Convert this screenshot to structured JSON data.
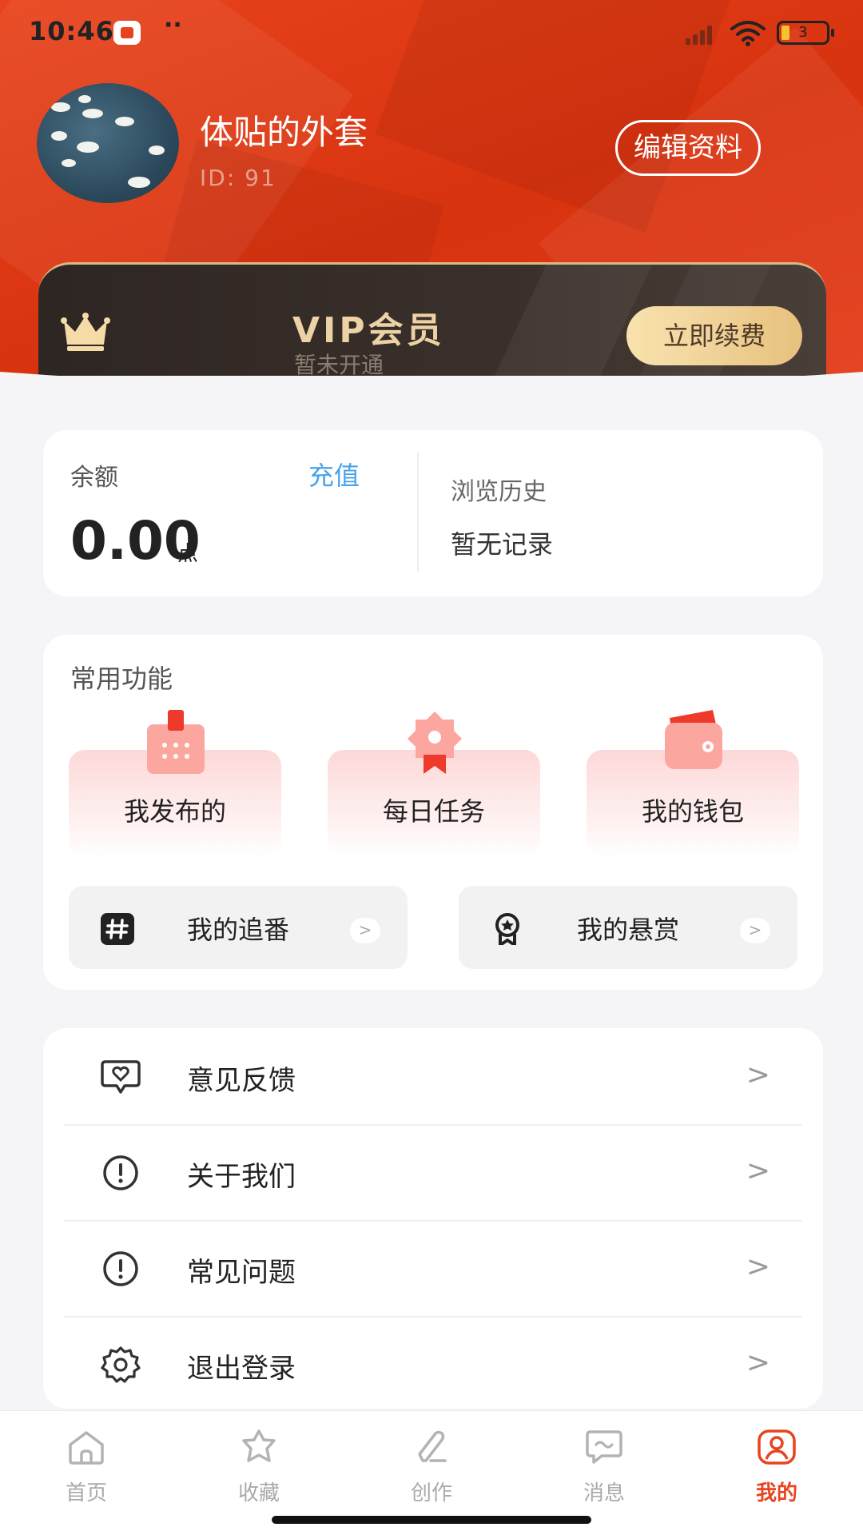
{
  "status_bar": {
    "time": "10:46",
    "dots": "··",
    "battery": "3"
  },
  "profile": {
    "username": "体贴的外套",
    "id_text": "ID: 91",
    "edit_label": "编辑资料"
  },
  "vip": {
    "title": "VIP会员",
    "subtitle": "暂未开通",
    "button": "立即续费"
  },
  "balance": {
    "label": "余额",
    "recharge": "充值",
    "amount": "0.00",
    "unit": "点",
    "history_label": "浏览历史",
    "history_value": "暂无记录"
  },
  "functions": {
    "title": "常用功能",
    "tiles": [
      {
        "label": "我发布的",
        "icon": "calendar-icon"
      },
      {
        "label": "每日任务",
        "icon": "badge-icon"
      },
      {
        "label": "我的钱包",
        "icon": "wallet-icon"
      }
    ],
    "quick": [
      {
        "label": "我的追番",
        "icon": "hashtag-icon"
      },
      {
        "label": "我的悬赏",
        "icon": "medal-icon"
      }
    ],
    "arrow": ">"
  },
  "menu": {
    "items": [
      {
        "label": "意见反馈",
        "icon": "feedback-heart-icon"
      },
      {
        "label": "关于我们",
        "icon": "info-alert-icon"
      },
      {
        "label": "常见问题",
        "icon": "question-alert-icon"
      },
      {
        "label": "退出登录",
        "icon": "gear-icon"
      }
    ],
    "arrow": ">"
  },
  "nav": {
    "items": [
      {
        "label": "首页",
        "icon": "home-icon"
      },
      {
        "label": "收藏",
        "icon": "star-icon"
      },
      {
        "label": "创作",
        "icon": "pencil-icon"
      },
      {
        "label": "消息",
        "icon": "message-icon"
      },
      {
        "label": "我的",
        "icon": "profile-icon"
      }
    ],
    "active": "我的"
  },
  "colors": {
    "brand_red": "#e8431c",
    "accent_blue": "#4aa3e8",
    "vip_gold": "#ecd2a4",
    "nav_active": "#e84420"
  }
}
